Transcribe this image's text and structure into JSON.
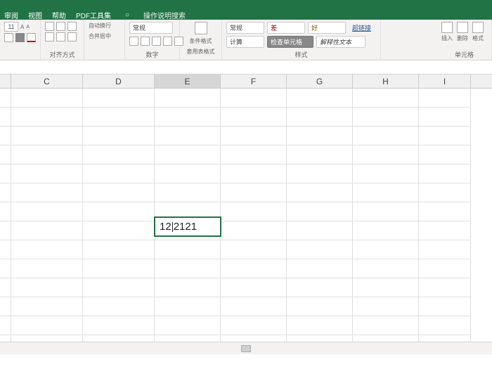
{
  "menu": {
    "items": [
      "审阅",
      "视图",
      "帮助",
      "PDF工具集"
    ],
    "tell_icon": "○",
    "tell": "操作说明搜索"
  },
  "ribbon": {
    "font": {
      "size": "11",
      "a_up": "A",
      "a_down": "A"
    },
    "alignment": {
      "label": "对齐方式",
      "wrap": "自动换行",
      "merge": "合并居中"
    },
    "number": {
      "label": "数字",
      "format": "常规"
    },
    "styles": {
      "label": "样式",
      "cond": "条件格式",
      "table": "套用表格式",
      "normal": "常规",
      "bad": "差",
      "calc": "计算",
      "cellstyle_btn": "检查单元格",
      "check": "检查单元格",
      "explain": "解释性文本",
      "good": "好",
      "link": "超链接"
    },
    "cells": {
      "label": "单元格",
      "insert": "插入",
      "delete": "删除",
      "format": "格式"
    }
  },
  "columns": [
    "C",
    "D",
    "E",
    "F",
    "G",
    "H",
    "I"
  ],
  "active_cell": {
    "col": "E",
    "value_before": "12",
    "value_after": "2121"
  },
  "chart_data": {
    "type": "table",
    "title": "",
    "columns": [
      "C",
      "D",
      "E",
      "F",
      "G",
      "H",
      "I"
    ],
    "rows": [
      {
        "C": "",
        "D": "",
        "E": "",
        "F": "",
        "G": "",
        "H": "",
        "I": ""
      },
      {
        "C": "",
        "D": "",
        "E": "",
        "F": "",
        "G": "",
        "H": "",
        "I": ""
      },
      {
        "C": "",
        "D": "",
        "E": "",
        "F": "",
        "G": "",
        "H": "",
        "I": ""
      },
      {
        "C": "",
        "D": "",
        "E": "",
        "F": "",
        "G": "",
        "H": "",
        "I": ""
      },
      {
        "C": "",
        "D": "",
        "E": "",
        "F": "",
        "G": "",
        "H": "",
        "I": ""
      },
      {
        "C": "",
        "D": "",
        "E": "",
        "F": "",
        "G": "",
        "H": "",
        "I": ""
      },
      {
        "C": "",
        "D": "",
        "E": "12'2121",
        "F": "",
        "G": "",
        "H": "",
        "I": ""
      },
      {
        "C": "",
        "D": "",
        "E": "",
        "F": "",
        "G": "",
        "H": "",
        "I": ""
      },
      {
        "C": "",
        "D": "",
        "E": "",
        "F": "",
        "G": "",
        "H": "",
        "I": ""
      },
      {
        "C": "",
        "D": "",
        "E": "",
        "F": "",
        "G": "",
        "H": "",
        "I": ""
      },
      {
        "C": "",
        "D": "",
        "E": "",
        "F": "",
        "G": "",
        "H": "",
        "I": ""
      },
      {
        "C": "",
        "D": "",
        "E": "",
        "F": "",
        "G": "",
        "H": "",
        "I": ""
      },
      {
        "C": "",
        "D": "",
        "E": "",
        "F": "",
        "G": "",
        "H": "",
        "I": ""
      },
      {
        "C": "",
        "D": "",
        "E": "",
        "F": "",
        "G": "",
        "H": "",
        "I": ""
      }
    ]
  }
}
